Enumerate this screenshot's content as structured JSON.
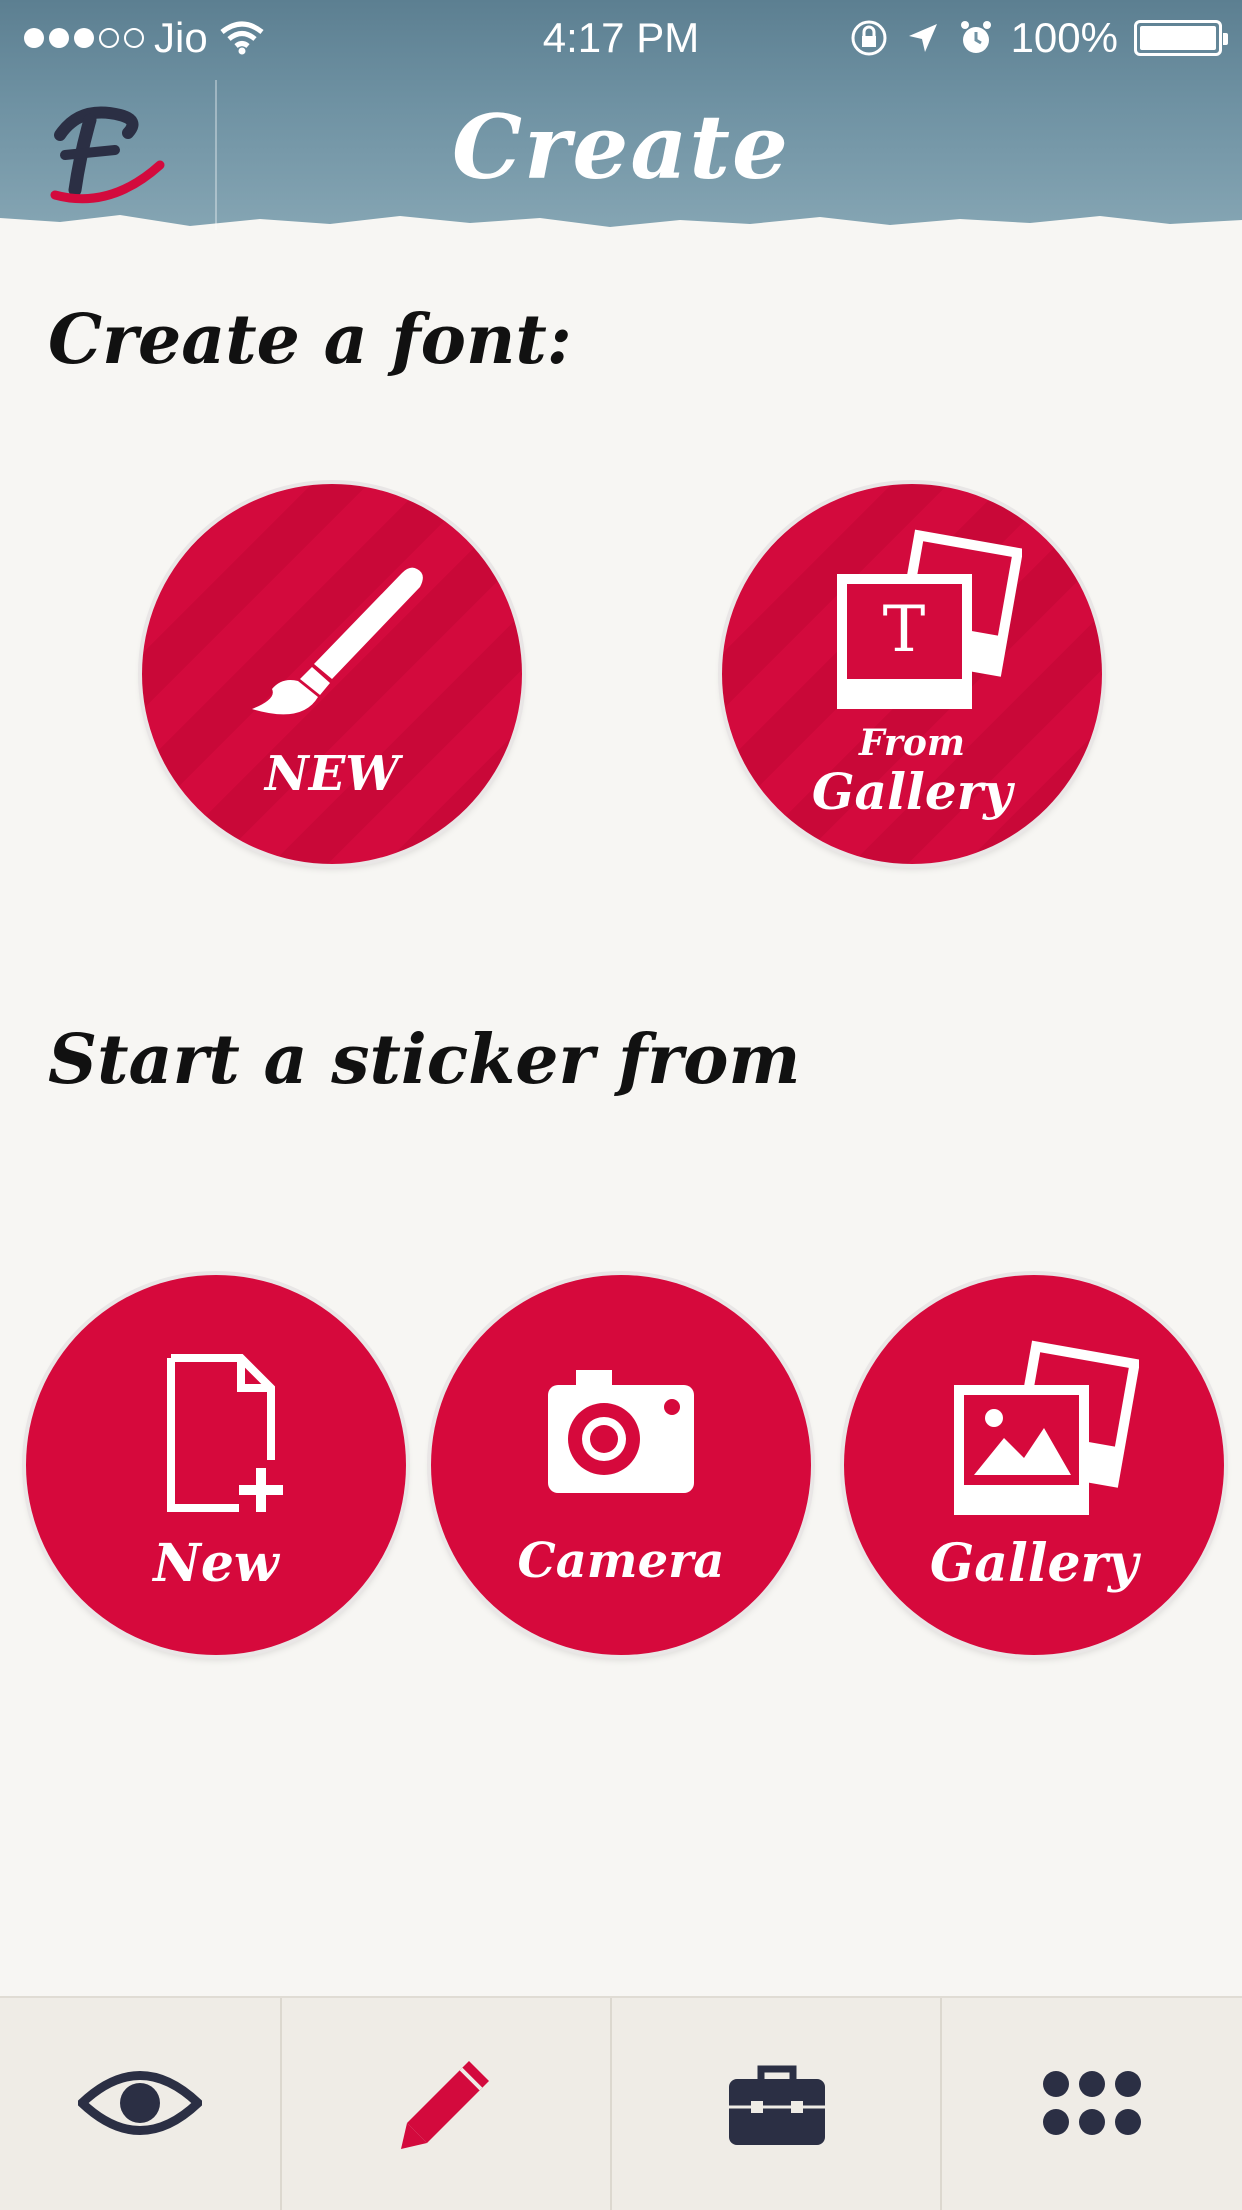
{
  "status_bar": {
    "carrier": "Jio",
    "time": "4:17 PM",
    "battery": "100%"
  },
  "header": {
    "title": "Create",
    "logo": "F"
  },
  "font_section": {
    "title": "Create a font:",
    "buttons": [
      {
        "label": "NEW",
        "icon": "paintbrush-icon"
      },
      {
        "label_line1": "From",
        "label_line2": "Gallery",
        "icon": "photo-T-icon"
      }
    ]
  },
  "sticker_section": {
    "title": "Start a sticker from",
    "buttons": [
      {
        "label": "New",
        "icon": "new-document-icon"
      },
      {
        "label": "Camera",
        "icon": "camera-icon"
      },
      {
        "label": "Gallery",
        "icon": "gallery-icon"
      }
    ]
  },
  "tabbar": {
    "tabs": [
      {
        "icon": "eye-icon",
        "color": "#2b2f44"
      },
      {
        "icon": "pencil-icon",
        "color": "#d30a3d"
      },
      {
        "icon": "briefcase-icon",
        "color": "#2b2f44"
      },
      {
        "icon": "grid-dots-icon",
        "color": "#2b2f44"
      }
    ]
  },
  "colors": {
    "accent": "#d30a3d",
    "header": "#6f92a3",
    "icon_dark": "#2b2f44"
  }
}
